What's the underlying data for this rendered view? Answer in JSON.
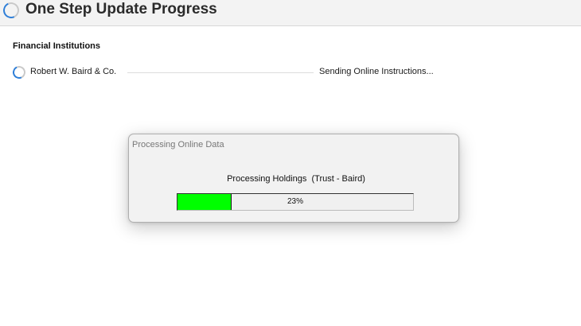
{
  "header": {
    "title": "One Step Update Progress",
    "icon": "loading-spinner-icon"
  },
  "section": {
    "title": "Financial Institutions"
  },
  "institutions": [
    {
      "name": "Robert W. Baird & Co.",
      "status": "Sending Online Instructions...",
      "icon": "loading-spinner-icon"
    }
  ],
  "dialog": {
    "title": "Processing Online Data",
    "message": "Processing Holdings  (Trust - Baird)",
    "progress_value": 0.23,
    "progress_label": "23%",
    "progress_color": "#00ff00"
  },
  "colors": {
    "accent": "#2f7fd8",
    "progress_fill": "#00ff00"
  }
}
